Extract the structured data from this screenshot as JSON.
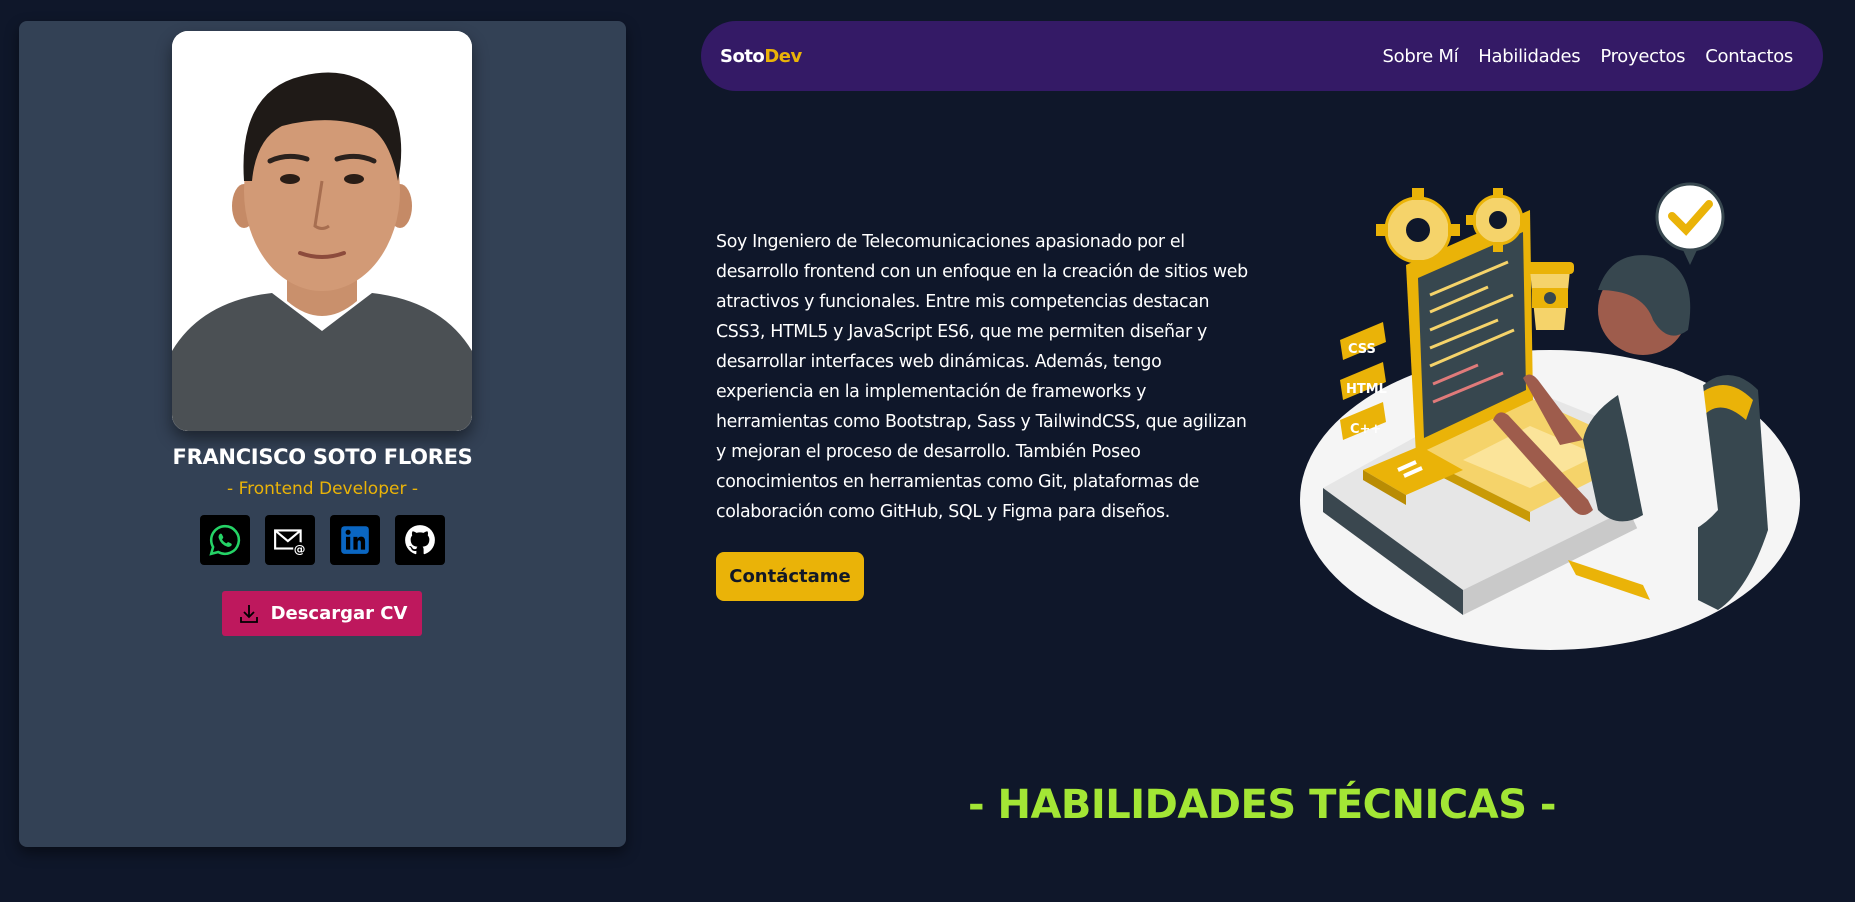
{
  "profile": {
    "name": "FRANCISCO SOTO FLORES",
    "role": "- Frontend Developer -",
    "cv_button": "Descargar CV",
    "socials": [
      {
        "icon": "whatsapp-icon",
        "color": "#25d366"
      },
      {
        "icon": "email-icon",
        "color": "#ffffff"
      },
      {
        "icon": "linkedin-icon",
        "color": "#0a66c2"
      },
      {
        "icon": "github-icon",
        "color": "#ffffff"
      }
    ]
  },
  "nav": {
    "logo_part1": "Soto",
    "logo_part2": "Dev",
    "links": [
      "Sobre Mí",
      "Habilidades",
      "Proyectos",
      "Contactos"
    ]
  },
  "hero": {
    "about": "Soy Ingeniero de Telecomunicaciones apasionado por el desarrollo frontend con un enfoque en la creación de sitios web atractivos y funcionales. Entre mis competencias destacan CSS3, HTML5 y JavaScript ES6, que me permiten diseñar y desarrollar interfaces web dinámicas. Además, tengo experiencia en la implementación de frameworks y herramientas como Bootstrap, Sass y TailwindCSS, que agilizan y mejoran el proceso de desarrollo. También Poseo conocimientos en herramientas como Git, plataformas de colaboración como GitHub, SQL y Figma para diseños.",
    "contact_button": "Contáctame",
    "illustration_labels": [
      "CSS",
      "HTML",
      "C++"
    ]
  },
  "skills": {
    "heading": "- HABILIDADES TÉCNICAS -"
  },
  "colors": {
    "background": "#0f172a",
    "card": "#334155",
    "navbar": "#341a66",
    "accent_yellow": "#eab308",
    "accent_pink": "#be185d",
    "accent_lime": "#a3e635"
  }
}
